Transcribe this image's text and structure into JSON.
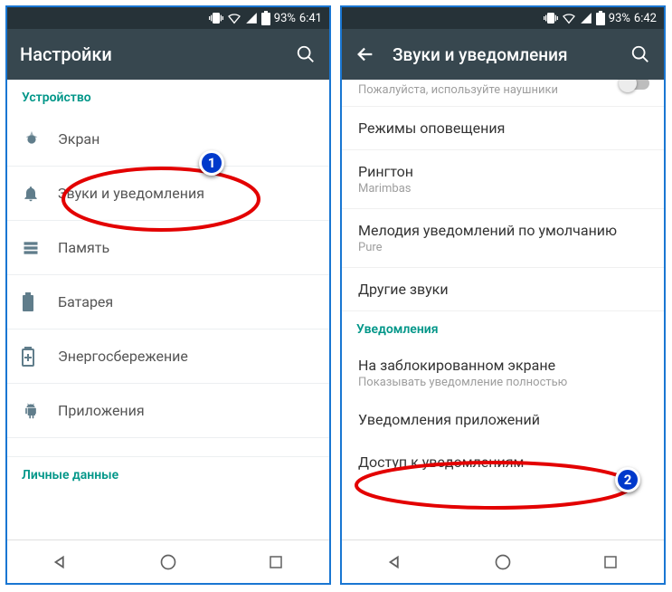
{
  "left": {
    "status": {
      "battery": "93%",
      "time": "6:41"
    },
    "appbar": {
      "title": "Настройки"
    },
    "section1": "Устройство",
    "items": [
      {
        "label": "Экран"
      },
      {
        "label": "Звуки и уведомления"
      },
      {
        "label": "Память"
      },
      {
        "label": "Батарея"
      },
      {
        "label": "Энергосбережение"
      },
      {
        "label": "Приложения"
      }
    ],
    "section2": "Личные данные",
    "badge1": "1"
  },
  "right": {
    "status": {
      "battery": "93%",
      "time": "6:42"
    },
    "appbar": {
      "title": "Звуки и уведомления"
    },
    "partial_sub": "Пожалуйста, используйте наушники",
    "rows": [
      {
        "primary": "Режимы оповещения"
      },
      {
        "primary": "Рингтон",
        "secondary": "Marimbas"
      },
      {
        "primary": "Мелодия уведомлений по умолчанию",
        "secondary": "Pure"
      },
      {
        "primary": "Другие звуки"
      }
    ],
    "section_notif": "Уведомления",
    "rows2": [
      {
        "primary": "На заблокированном экране",
        "secondary": "Показывать уведомление полностью"
      },
      {
        "primary": "Уведомления приложений"
      },
      {
        "primary": "Доступ к уведомлениям"
      }
    ],
    "badge2": "2"
  }
}
